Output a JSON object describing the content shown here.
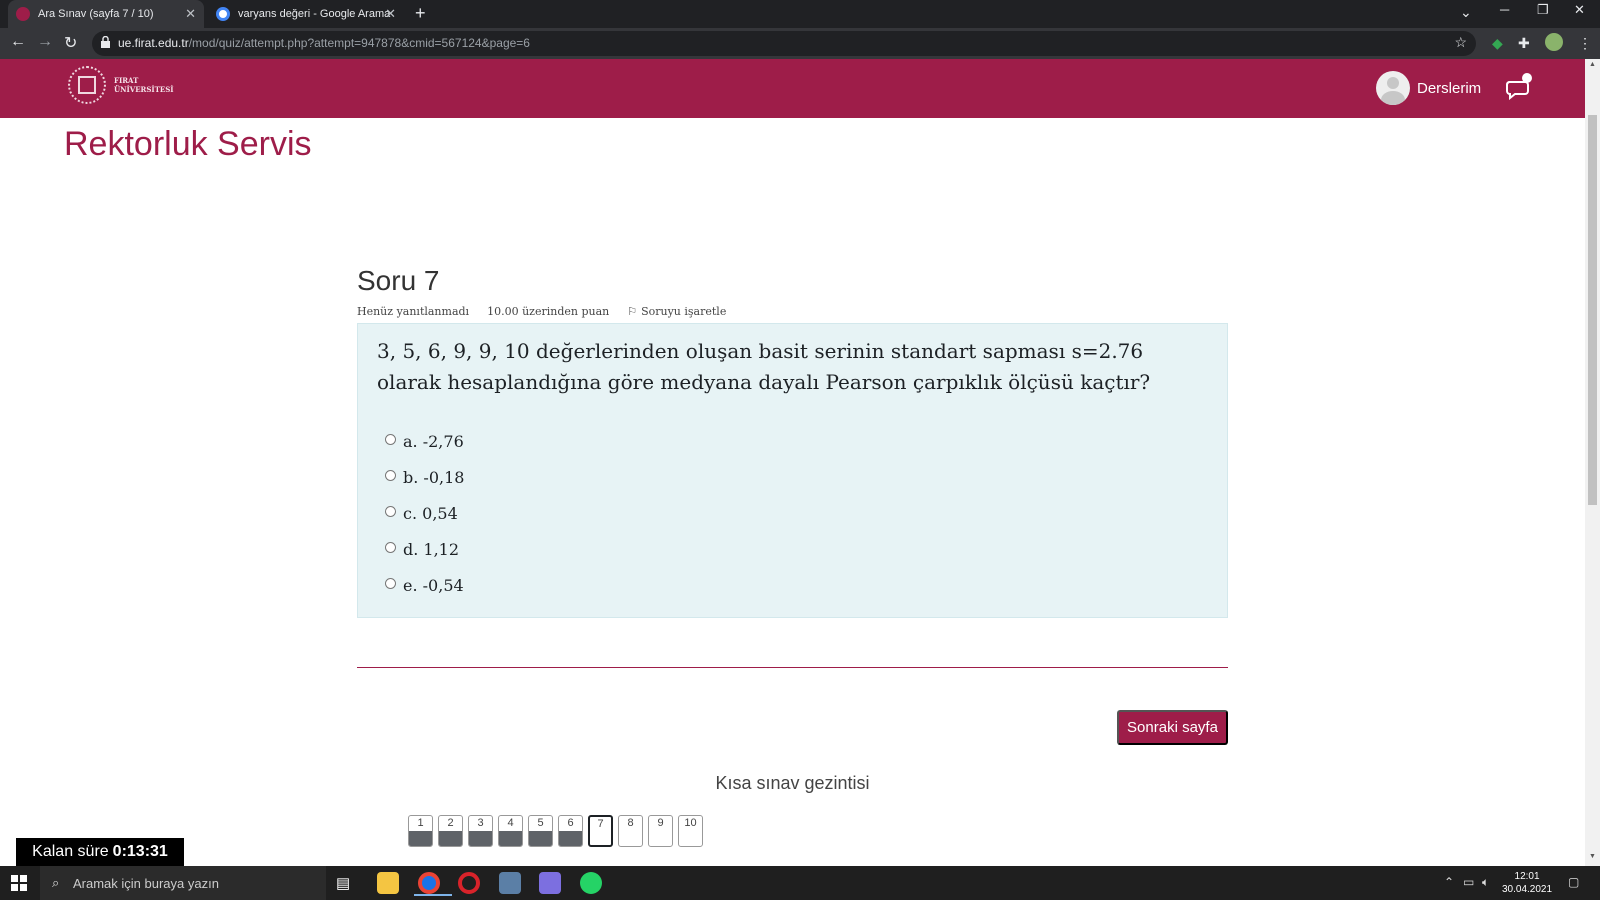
{
  "browser": {
    "tabs": [
      {
        "title": "Ara Sınav (sayfa 7 / 10)",
        "active": true
      },
      {
        "title": "varyans değeri - Google Arama",
        "active": false
      }
    ],
    "url_host": "ue.firat.edu.tr",
    "url_path": "/mod/quiz/attempt.php?attempt=947878&cmid=567124&page=6"
  },
  "header": {
    "logo_text_line1": "FIRAT",
    "logo_text_line2": "ÜNİVERSİTESİ",
    "user_label": "Derslerim",
    "brand_color": "#9e1d49"
  },
  "page": {
    "title": "Rektorluk Servis"
  },
  "question": {
    "number_label": "Soru 7",
    "status": "Henüz yanıtlanmadı",
    "points": "10.00 üzerinden puan",
    "flag_label": "Soruyu işaretle",
    "text": "3, 5, 6, 9, 9, 10 değerlerinden oluşan basit serinin standart sapması s=2.76 olarak hesaplandığına göre medyana dayalı Pearson çarpıklık ölçüsü kaçtır?",
    "options": [
      {
        "label": "a. -2,76"
      },
      {
        "label": "b. -0,18"
      },
      {
        "label": "c. 0,54"
      },
      {
        "label": "d. 1,12"
      },
      {
        "label": "e. -0,54"
      }
    ]
  },
  "next_button": "Sonraki sayfa",
  "quiz_nav": {
    "title": "Kısa sınav gezintisi",
    "items": [
      {
        "label": "1",
        "state": "answered"
      },
      {
        "label": "2",
        "state": "answered"
      },
      {
        "label": "3",
        "state": "answered"
      },
      {
        "label": "4",
        "state": "answered"
      },
      {
        "label": "5",
        "state": "answered"
      },
      {
        "label": "6",
        "state": "answered"
      },
      {
        "label": "7",
        "state": "current"
      },
      {
        "label": "8",
        "state": "unanswered"
      },
      {
        "label": "9",
        "state": "unanswered"
      },
      {
        "label": "10",
        "state": "unanswered"
      }
    ]
  },
  "timer": {
    "label": "Kalan süre",
    "value": "0:13:31"
  },
  "taskbar": {
    "search_placeholder": "Aramak için buraya yazın",
    "time": "12:01",
    "date": "30.04.2021"
  }
}
